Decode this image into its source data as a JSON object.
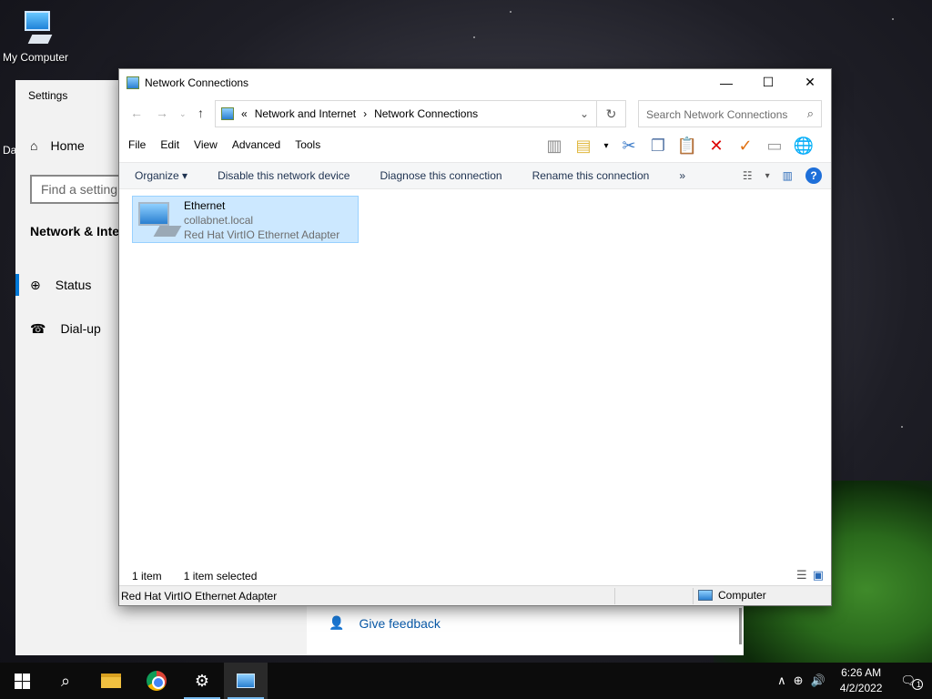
{
  "desktop": {
    "icon_label": "My Computer",
    "partial_label": "Da"
  },
  "settings": {
    "title": "Settings",
    "home_label": "Home",
    "search_placeholder": "Find a setting",
    "section_title": "Network & Inte",
    "nav_items": [
      {
        "label": "Status"
      },
      {
        "label": "Dial-up"
      }
    ],
    "feedback_label": "Give feedback"
  },
  "explorer": {
    "title": "Network Connections",
    "breadcrumb": {
      "prefix": "«",
      "items": [
        "Network and Internet",
        "Network Connections"
      ],
      "separator": "›"
    },
    "search_placeholder": "Search Network Connections",
    "menu": [
      "File",
      "Edit",
      "View",
      "Advanced",
      "Tools"
    ],
    "commands": {
      "organize": "Organize ▾",
      "disable": "Disable this network device",
      "diagnose": "Diagnose this connection",
      "rename": "Rename this connection",
      "more": "»"
    },
    "connection": {
      "name": "Ethernet",
      "domain": "collabnet.local",
      "adapter": "Red Hat VirtIO Ethernet Adapter"
    },
    "status": {
      "count": "1 item",
      "selected": "1 item selected"
    },
    "statusbar": {
      "left": "Red Hat VirtIO Ethernet Adapter",
      "right": "Computer"
    }
  },
  "taskbar": {
    "time": "6:26 AM",
    "date": "4/2/2022",
    "notification_count": "1"
  }
}
